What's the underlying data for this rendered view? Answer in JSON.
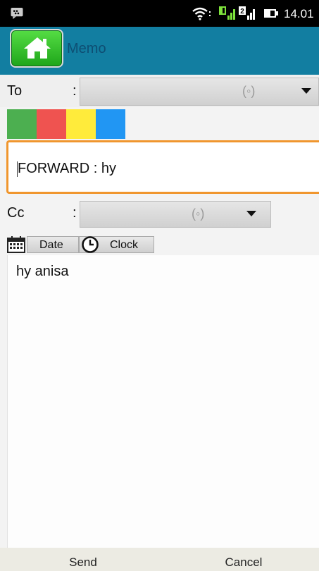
{
  "status_bar": {
    "time": "14.01",
    "icons": [
      "bbm-icon",
      "wifi-icon",
      "signal-icon",
      "signal-2-icon",
      "battery-icon"
    ]
  },
  "app_bar": {
    "title": "Memo",
    "home_icon": "home-icon"
  },
  "to": {
    "label": "To",
    "colon": ":",
    "spinner_glyph": "(◦)"
  },
  "color_swatches": [
    "#4caf50",
    "#ef5350",
    "#ffeb3b",
    "#2196f3"
  ],
  "subject": {
    "value": "FORWARD : hy"
  },
  "cc": {
    "label": "Cc",
    "colon": ":",
    "spinner_glyph": "(◦)"
  },
  "date_button": {
    "label": "Date",
    "icon": "calendar-icon"
  },
  "clock_button": {
    "label": "Clock",
    "icon": "clock-icon"
  },
  "body": {
    "value": "hy anisa"
  },
  "bottom": {
    "send_label": "Send",
    "cancel_label": "Cancel"
  }
}
